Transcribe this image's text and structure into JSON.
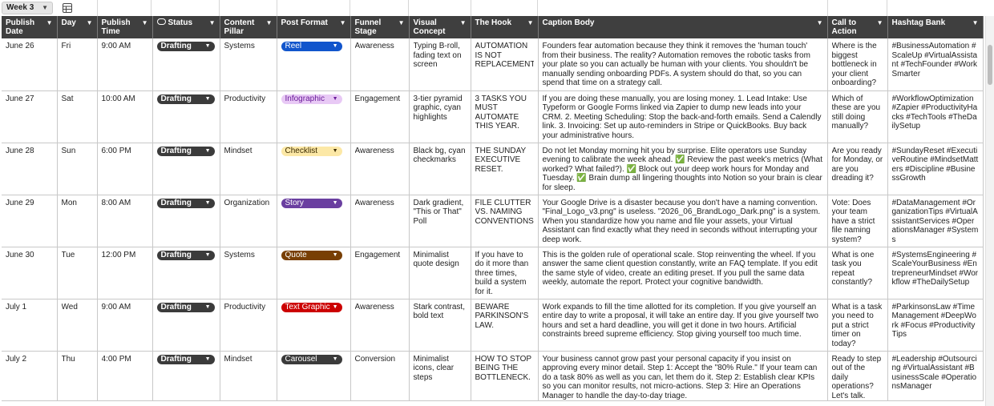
{
  "sheet": {
    "tab_label": "Week 3",
    "view_icon": "grid-view-icon"
  },
  "columns": [
    {
      "label": "Publish Date",
      "icon": ""
    },
    {
      "label": "Day",
      "icon": ""
    },
    {
      "label": "Publish Time",
      "icon": ""
    },
    {
      "label": "Status",
      "icon": "smart-chip-icon"
    },
    {
      "label": "Content Pillar",
      "icon": ""
    },
    {
      "label": "Post Format",
      "icon": ""
    },
    {
      "label": "Funnel Stage",
      "icon": ""
    },
    {
      "label": "Visual Concept",
      "icon": ""
    },
    {
      "label": "The Hook",
      "icon": ""
    },
    {
      "label": "Caption Body",
      "icon": ""
    },
    {
      "label": "Call to Action",
      "icon": ""
    },
    {
      "label": "Hashtag Bank",
      "icon": ""
    }
  ],
  "format_colors": {
    "Reel": {
      "bg": "#1155cc",
      "fg": "#ffffff"
    },
    "Infographic": {
      "bg": "#e8c9f5",
      "fg": "#6a1b9a"
    },
    "Checklist": {
      "bg": "#fce8a6",
      "fg": "#3b2a00"
    },
    "Story": {
      "bg": "#6a3fa0",
      "fg": "#ffffff"
    },
    "Quote": {
      "bg": "#783f04",
      "fg": "#ffffff"
    },
    "Text Graphic": {
      "bg": "#cc0000",
      "fg": "#ffffff"
    },
    "Carousel": {
      "bg": "#3b3b3b",
      "fg": "#ffffff"
    }
  },
  "rows": [
    {
      "date": "June 26",
      "day": "Fri",
      "time": "9:00 AM",
      "status": "Drafting",
      "pillar": "Systems",
      "format": "Reel",
      "funnel": "Awareness",
      "visual": "Typing B-roll, fading text on screen",
      "hook": "AUTOMATION IS NOT REPLACEMENT.",
      "caption": "Founders fear automation because they think it removes the 'human touch' from their business. The reality? Automation removes the robotic tasks from your plate so you can actually be human with your clients. You shouldn't be manually sending onboarding PDFs. A system should do that, so you can spend that time on a strategy call.",
      "cta": "Where is the biggest bottleneck in your client onboarding?",
      "hashtags": "#BusinessAutomation #ScaleUp #VirtualAssistant #TechFounder #WorkSmarter"
    },
    {
      "date": "June 27",
      "day": "Sat",
      "time": "10:00 AM",
      "status": "Drafting",
      "pillar": "Productivity",
      "format": "Infographic",
      "funnel": "Engagement",
      "visual": "3-tier pyramid graphic, cyan highlights",
      "hook": "3 TASKS YOU MUST AUTOMATE THIS YEAR.",
      "caption": "If you are doing these manually, you are losing money. 1. Lead Intake: Use Typeform or Google Forms linked via Zapier to dump new leads into your CRM. 2. Meeting Scheduling: Stop the back-and-forth emails. Send a Calendly link. 3. Invoicing: Set up auto-reminders in Stripe or QuickBooks. Buy back your administrative hours.",
      "cta": "Which of these are you still doing manually?",
      "hashtags": "#WorkflowOptimization #Zapier #ProductivityHacks #TechTools #TheDailySetup"
    },
    {
      "date": "June 28",
      "day": "Sun",
      "time": "6:00 PM",
      "status": "Drafting",
      "pillar": "Mindset",
      "format": "Checklist",
      "funnel": "Awareness",
      "visual": "Black bg, cyan checkmarks",
      "hook": "THE SUNDAY EXECUTIVE RESET.",
      "caption": "Do not let Monday morning hit you by surprise. Elite operators use Sunday evening to calibrate the week ahead. ✅ Review the past week's metrics (What worked? What failed?). ✅ Block out your deep work hours for Monday and Tuesday. ✅ Brain dump all lingering thoughts into Notion so your brain is clear for sleep.",
      "cta": "Are you ready for Monday, or are you dreading it?",
      "hashtags": "#SundayReset #ExecutiveRoutine #MindsetMatters #Discipline #BusinessGrowth"
    },
    {
      "date": "June 29",
      "day": "Mon",
      "time": "8:00 AM",
      "status": "Drafting",
      "pillar": "Organization",
      "format": "Story",
      "funnel": "Awareness",
      "visual": "Dark gradient, \"This or That\" Poll",
      "hook": "FILE CLUTTER VS. NAMING CONVENTIONS",
      "caption": "Your Google Drive is a disaster because you don't have a naming convention. \"Final_Logo_v3.png\" is useless. \"2026_06_BrandLogo_Dark.png\" is a system. When you standardize how you name and file your assets, your Virtual Assistant can find exactly what they need in seconds without interrupting your deep work.",
      "cta": "Vote: Does your team have a strict file naming system?",
      "hashtags": "#DataManagement #OrganizationTips #VirtualAssistantServices #OperationsManager #Systems"
    },
    {
      "date": "June 30",
      "day": "Tue",
      "time": "12:00 PM",
      "status": "Drafting",
      "pillar": "Systems",
      "format": "Quote",
      "funnel": "Engagement",
      "visual": "Minimalist quote design",
      "hook": "If you have to do it more than three times, build a system for it.",
      "caption": "This is the golden rule of operational scale. Stop reinventing the wheel. If you answer the same client question constantly, write an FAQ template. If you edit the same style of video, create an editing preset. If you pull the same data weekly, automate the report. Protect your cognitive bandwidth.",
      "cta": "What is one task you repeat constantly?",
      "hashtags": "#SystemsEngineering #ScaleYourBusiness #EntrepreneurMindset #Workflow #TheDailySetup"
    },
    {
      "date": "July 1",
      "day": "Wed",
      "time": "9:00 AM",
      "status": "Drafting",
      "pillar": "Productivity",
      "format": "Text Graphic",
      "funnel": "Awareness",
      "visual": "Stark contrast, bold text",
      "hook": "BEWARE PARKINSON'S LAW.",
      "caption": "Work expands to fill the time allotted for its completion. If you give yourself an entire day to write a proposal, it will take an entire day. If you give yourself two hours and set a hard deadline, you will get it done in two hours. Artificial constraints breed supreme efficiency. Stop giving yourself too much time.",
      "cta": "What is a task you need to put a strict timer on today?",
      "hashtags": "#ParkinsonsLaw #TimeManagement #DeepWork #Focus #ProductivityTips"
    },
    {
      "date": "July 2",
      "day": "Thu",
      "time": "4:00 PM",
      "status": "Drafting",
      "pillar": "Mindset",
      "format": "Carousel",
      "funnel": "Conversion",
      "visual": "Minimalist icons, clear steps",
      "hook": "HOW TO STOP BEING THE BOTTLENECK.",
      "caption": "Your business cannot grow past your personal capacity if you insist on approving every minor detail. Step 1: Accept the \"80% Rule.\" If your team can do a task 80% as well as you can, let them do it. Step 2: Establish clear KPIs so you can monitor results, not micro-actions. Step 3: Hire an Operations Manager to handle the day-to-day triage.",
      "cta": "Ready to step out of the daily operations? Let's talk.",
      "hashtags": "#Leadership #Outsourcing #VirtualAssistant #BusinessScale #OperationsManager"
    }
  ]
}
